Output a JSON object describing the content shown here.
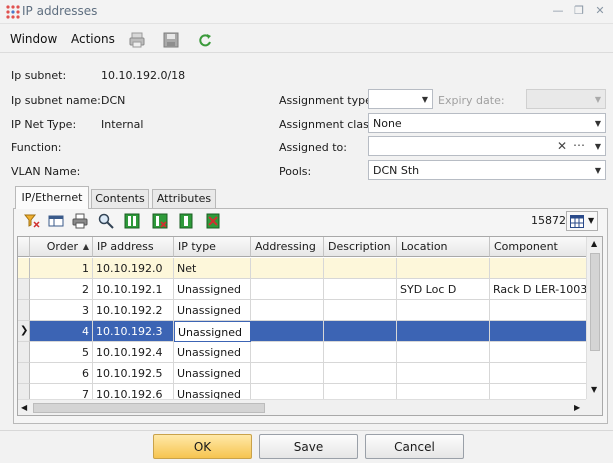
{
  "window": {
    "title": "IP addresses"
  },
  "menu": {
    "window_label": "Window",
    "actions_label": "Actions"
  },
  "form": {
    "ip_subnet_label": "Ip subnet:",
    "ip_subnet_value": "10.10.192.0/18",
    "ip_subnet_name_label": "Ip subnet name:",
    "ip_subnet_name_value": "DCN",
    "ip_net_type_label": "IP Net Type:",
    "ip_net_type_value": "Internal",
    "function_label": "Function:",
    "vlan_name_label": "VLAN Name:",
    "assignment_type_label": "Assignment type:",
    "assignment_type_value": "",
    "expiry_date_label": "Expiry date:",
    "expiry_date_value": "",
    "assignment_class_label": "Assignment class:",
    "assignment_class_value": "None",
    "assigned_to_label": "Assigned to:",
    "assigned_to_value": "",
    "pools_label": "Pools:",
    "pools_value": "DCN Sth"
  },
  "tabs": [
    {
      "label": "IP/Ethernet"
    },
    {
      "label": "Contents"
    },
    {
      "label": "Attributes"
    }
  ],
  "toolbar": {
    "count": "15872"
  },
  "table": {
    "columns": [
      "Order",
      "IP address",
      "IP type",
      "Addressing",
      "Description",
      "Location",
      "Component"
    ],
    "rows": [
      {
        "order": "1",
        "ip": "10.10.192.0",
        "type": "Net",
        "addressing": "",
        "description": "",
        "location": "",
        "component": ""
      },
      {
        "order": "2",
        "ip": "10.10.192.1",
        "type": "Unassigned",
        "addressing": "",
        "description": "",
        "location": "SYD Loc D",
        "component": "Rack D LER-1003"
      },
      {
        "order": "3",
        "ip": "10.10.192.2",
        "type": "Unassigned",
        "addressing": "",
        "description": "",
        "location": "",
        "component": ""
      },
      {
        "order": "4",
        "ip": "10.10.192.3",
        "type": "Unassigned",
        "addressing": "",
        "description": "",
        "location": "",
        "component": ""
      },
      {
        "order": "5",
        "ip": "10.10.192.4",
        "type": "Unassigned",
        "addressing": "",
        "description": "",
        "location": "",
        "component": ""
      },
      {
        "order": "6",
        "ip": "10.10.192.5",
        "type": "Unassigned",
        "addressing": "",
        "description": "",
        "location": "",
        "component": ""
      },
      {
        "order": "7",
        "ip": "10.10.192.6",
        "type": "Unassigned",
        "addressing": "",
        "description": "",
        "location": "",
        "component": ""
      }
    ]
  },
  "buttons": {
    "ok": "OK",
    "save": "Save",
    "cancel": "Cancel"
  },
  "colors": {
    "selection": "#3c64b4",
    "highlight_row": "#fdf7da",
    "ok_button": "#f6c450"
  }
}
